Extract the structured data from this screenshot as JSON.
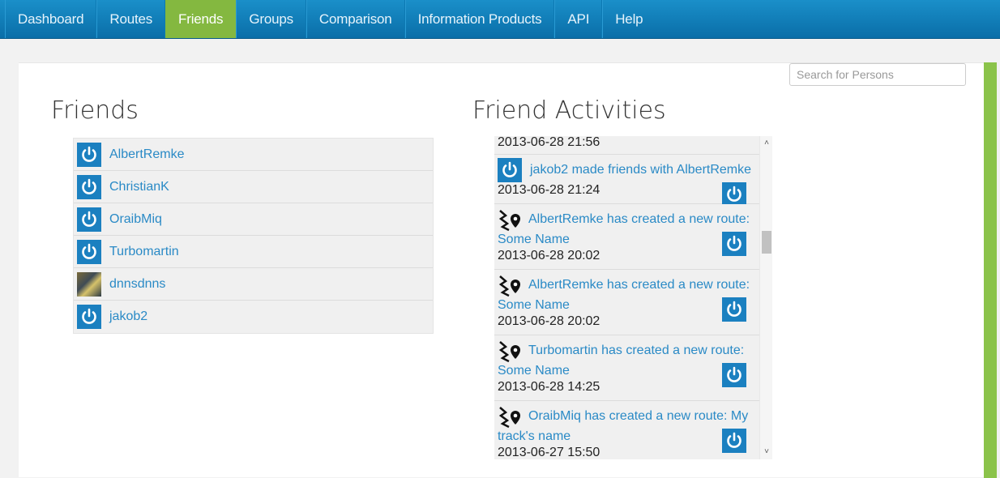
{
  "nav": {
    "items": [
      {
        "label": "Dashboard",
        "active": false
      },
      {
        "label": "Routes",
        "active": false
      },
      {
        "label": "Friends",
        "active": true
      },
      {
        "label": "Groups",
        "active": false
      },
      {
        "label": "Comparison",
        "active": false
      },
      {
        "label": "Information Products",
        "active": false
      },
      {
        "label": "API",
        "active": false
      },
      {
        "label": "Help",
        "active": false
      }
    ]
  },
  "search": {
    "placeholder": "Search for Persons",
    "value": ""
  },
  "friends": {
    "title": "Friends",
    "items": [
      {
        "name": "AlbertRemke",
        "avatar": "power-icon"
      },
      {
        "name": "ChristianK",
        "avatar": "power-icon"
      },
      {
        "name": "OraibMiq",
        "avatar": "power-icon"
      },
      {
        "name": "Turbomartin",
        "avatar": "power-icon"
      },
      {
        "name": "dnnsdnns",
        "avatar": "photo"
      },
      {
        "name": "jakob2",
        "avatar": "power-icon"
      }
    ]
  },
  "activities": {
    "title": "Friend Activities",
    "items": [
      {
        "type": "partial",
        "text": "",
        "time": "2013-06-28 21:56"
      },
      {
        "type": "friend",
        "text": "jakob2 made friends with AlbertRemke",
        "time": "2013-06-28 21:24"
      },
      {
        "type": "route",
        "text": "AlbertRemke has created a new route:",
        "text2": "Some Name",
        "time": "2013-06-28 20:02"
      },
      {
        "type": "route",
        "text": "AlbertRemke has created a new route:",
        "text2": "Some Name",
        "time": "2013-06-28 20:02"
      },
      {
        "type": "route",
        "text": "Turbomartin has created a new route:",
        "text2": "Some Name",
        "time": "2013-06-28 14:25"
      },
      {
        "type": "route",
        "text": "OraibMiq has created a new route: My",
        "text2": "track's name",
        "time": "2013-06-27 15:50"
      }
    ]
  },
  "colors": {
    "nav": "#0a6ea8",
    "nav_active": "#84b840",
    "link": "#2a8ac6",
    "avatar": "#1b80c0",
    "side_bar": "#8bc34a"
  }
}
